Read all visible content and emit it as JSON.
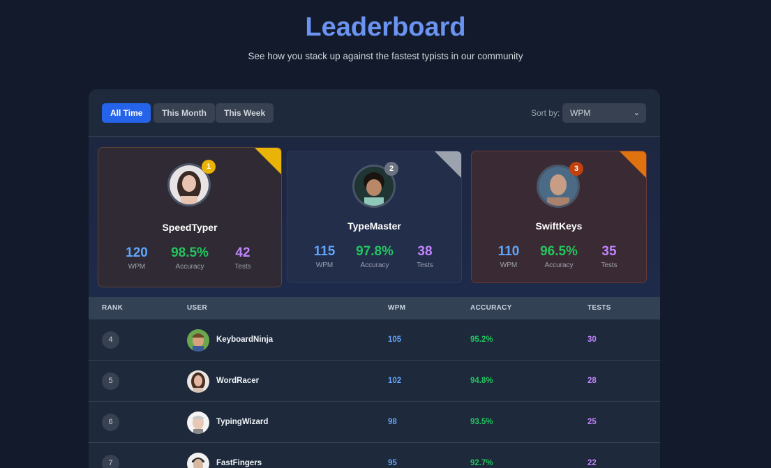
{
  "header": {
    "title": "Leaderboard",
    "subtitle": "See how you stack up against the fastest typists in our community"
  },
  "filters": {
    "tabs": [
      "All Time",
      "This Month",
      "This Week"
    ],
    "active_tab": "All Time",
    "sort_label": "Sort by:",
    "sort_value": "WPM"
  },
  "top3": [
    {
      "rank": "1",
      "name": "SpeedTyper",
      "wpm": "120",
      "accuracy": "98.5%",
      "tests": "42",
      "medal": "gold",
      "badge_color": "#eab308"
    },
    {
      "rank": "2",
      "name": "TypeMaster",
      "wpm": "115",
      "accuracy": "97.8%",
      "tests": "38",
      "medal": "silver",
      "badge_color": "#6b7280"
    },
    {
      "rank": "3",
      "name": "SwiftKeys",
      "wpm": "110",
      "accuracy": "96.5%",
      "tests": "35",
      "medal": "bronze",
      "badge_color": "#c2410c"
    }
  ],
  "stat_labels": {
    "wpm": "WPM",
    "accuracy": "Accuracy",
    "tests": "Tests"
  },
  "table": {
    "columns": [
      "RANK",
      "USER",
      "WPM",
      "ACCURACY",
      "TESTS"
    ],
    "rows": [
      {
        "rank": "4",
        "user": "KeyboardNinja",
        "wpm": "105",
        "accuracy": "95.2%",
        "tests": "30"
      },
      {
        "rank": "5",
        "user": "WordRacer",
        "wpm": "102",
        "accuracy": "94.8%",
        "tests": "28"
      },
      {
        "rank": "6",
        "user": "TypingWizard",
        "wpm": "98",
        "accuracy": "93.5%",
        "tests": "25"
      },
      {
        "rank": "7",
        "user": "FastFingers",
        "wpm": "95",
        "accuracy": "92.7%",
        "tests": "22"
      }
    ]
  },
  "colors": {
    "accent": "#2563eb",
    "wpm": "#60a5fa",
    "accuracy": "#22c55e",
    "tests": "#c084fc",
    "title": "#6b93f0"
  }
}
